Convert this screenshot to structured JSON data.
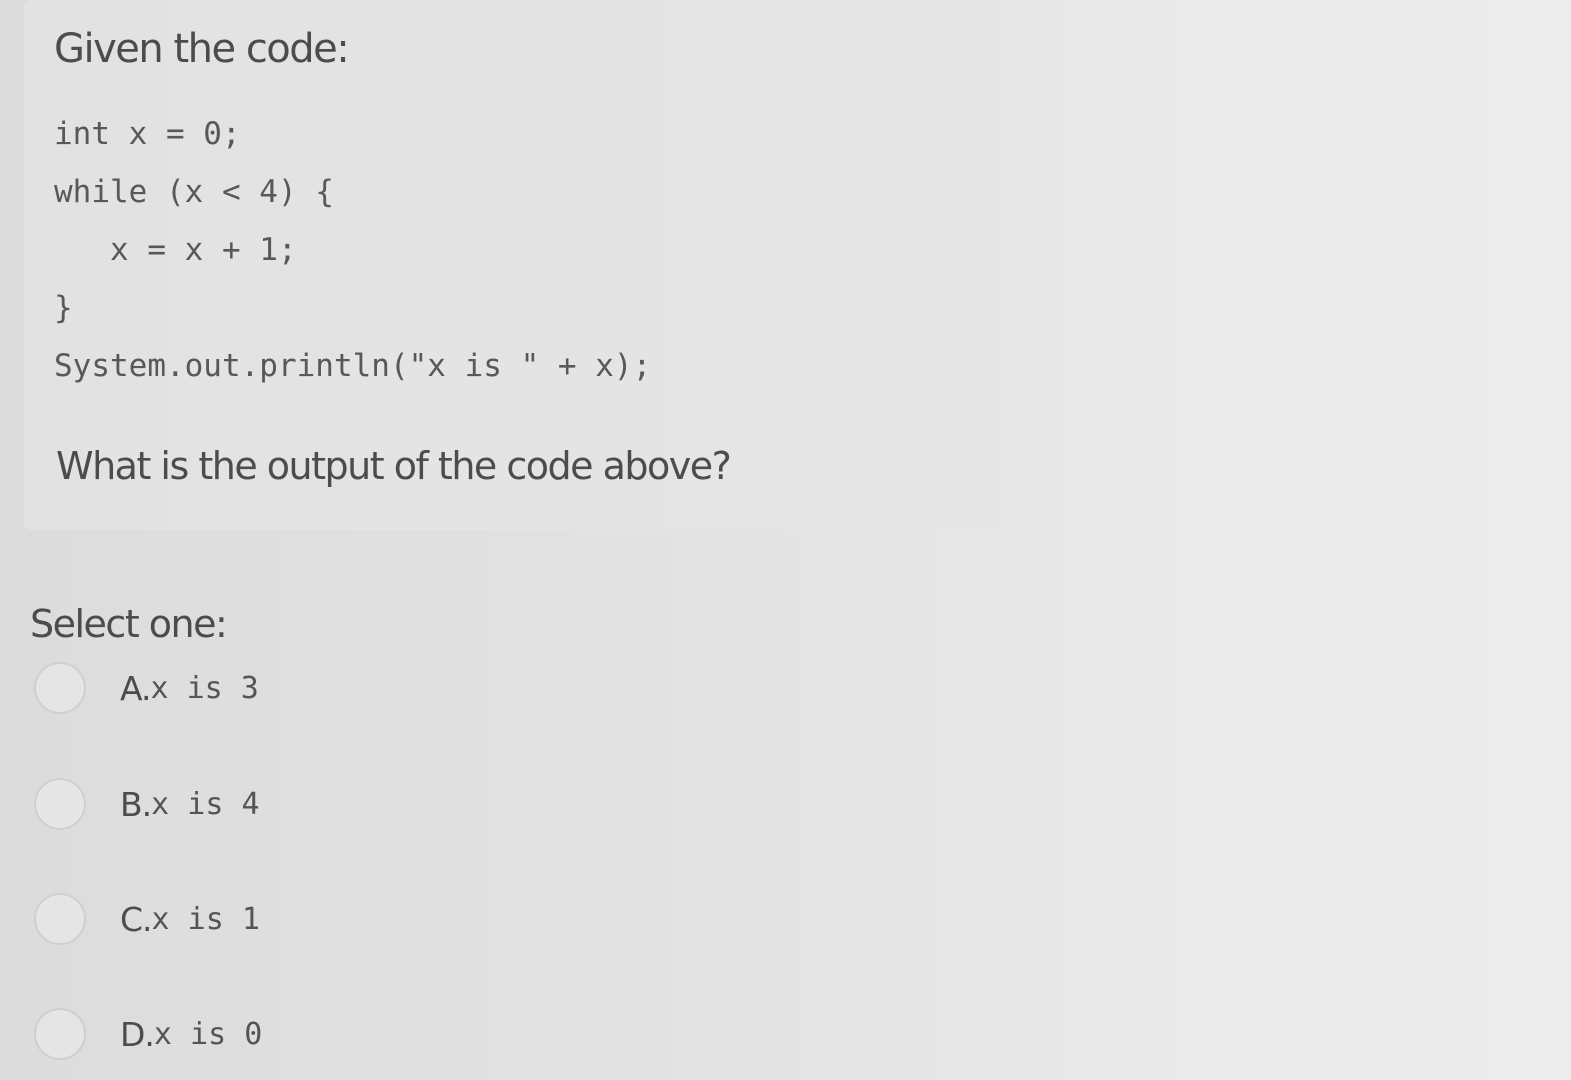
{
  "question": {
    "intro": "Given the code:",
    "code_lines": [
      "int x = 0;",
      "while (x < 4) {",
      "   x = x + 1;",
      "}",
      "System.out.println(\"x is \" + x);"
    ],
    "prompt": "What is the output of the code above?"
  },
  "answers": {
    "label": "Select one:",
    "options": [
      {
        "letter": "A.",
        "text": "x is 3"
      },
      {
        "letter": "B.",
        "text": "x is 4"
      },
      {
        "letter": "C.",
        "text": "x is 1"
      },
      {
        "letter": "D.",
        "text": "x is 0"
      }
    ]
  }
}
